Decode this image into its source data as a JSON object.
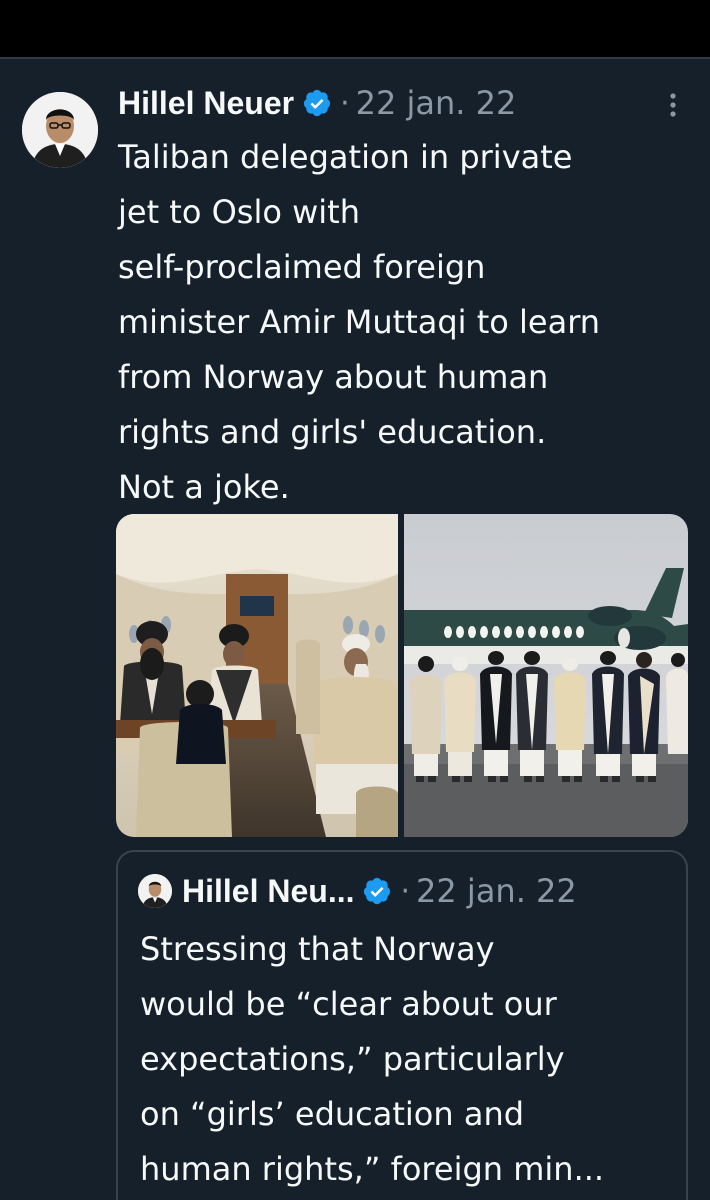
{
  "colors": {
    "background": "#15202b",
    "top_bar": "#000000",
    "text_primary": "#f7f9f9",
    "text_secondary": "#8b98a5",
    "verified": "#1d9bf0",
    "border": "#38444d"
  },
  "tweet": {
    "author_name": "Hillel Neuer",
    "verified": true,
    "separator": "·",
    "date": "22 jan. 22",
    "text": "Taliban delegation in private\njet to Oslo with\nself-proclaimed foreign\nminister Amir Muttaqi to learn\nfrom Norway about human\nrights and girls' education.\nNot a joke.",
    "icons": {
      "avatar": "avatar-photo",
      "verified": "verified-badge-icon",
      "more": "more-options-icon"
    },
    "media": [
      {
        "kind": "photo",
        "icon": "jet-interior-photo"
      },
      {
        "kind": "photo",
        "icon": "delegation-on-tarmac-photo"
      }
    ]
  },
  "quoted_tweet": {
    "author_name": "Hillel Neu...",
    "verified": true,
    "separator": "·",
    "date": "22 jan. 22",
    "text": "Stressing that Norway\nwould be “clear about our\nexpectations,” particularly\non “girls’ education and\nhuman rights,” foreign min..."
  }
}
